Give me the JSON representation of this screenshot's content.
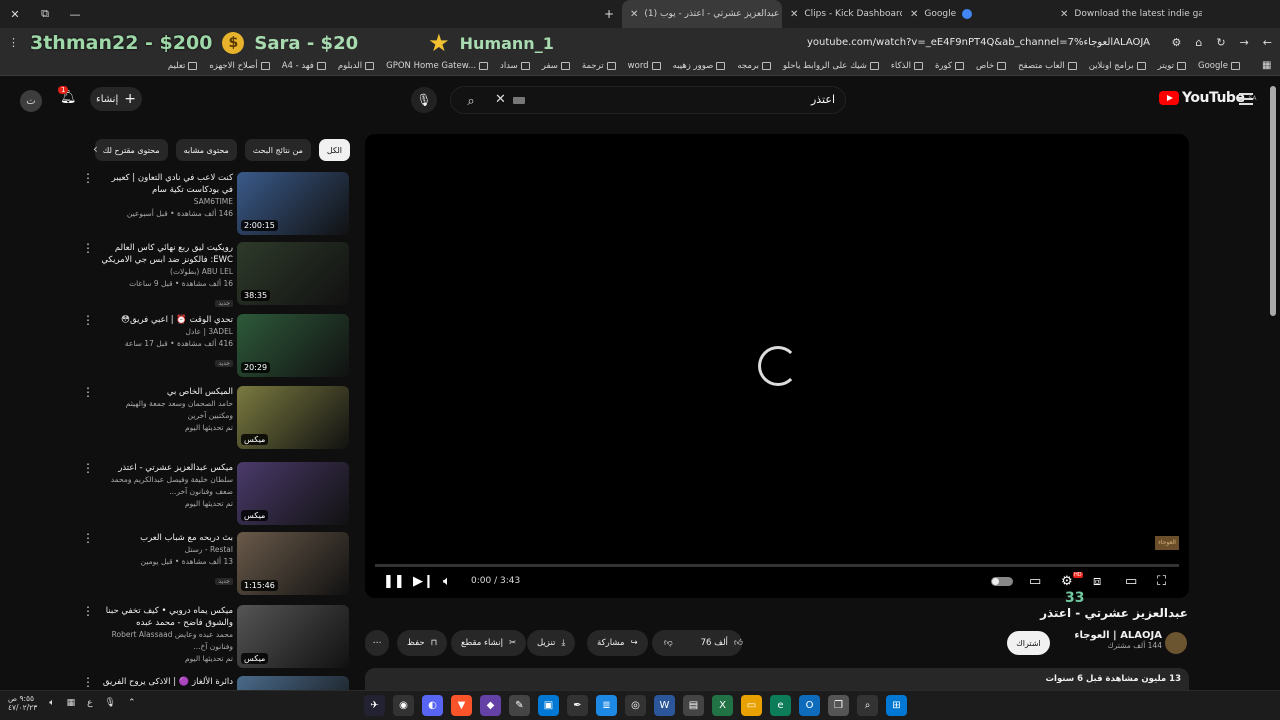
{
  "browser": {
    "tabs": [
      {
        "title": "(1) عبدالعزيز عشرتي - اعتذر - يوب",
        "active": true,
        "fav": "#ff0000"
      },
      {
        "title": "Clips - Kick Dashboard",
        "active": false,
        "fav": "#53fc18"
      },
      {
        "title": "Google",
        "active": false,
        "fav": "#4285f4"
      },
      {
        "title": "Download the latest indie gam",
        "active": false,
        "fav": "#fa5c5c"
      }
    ],
    "url": "youtube.com/watch?v=_eE4F9nPT4Q&ab_channel=7%العوجاءALAOJA",
    "bookmarks": [
      "Google",
      "تويتر",
      "برامج اونلاين",
      "العاب متصفح",
      "خاص",
      "كورة",
      "الذكاء",
      "شيك على الروابط ياحلو",
      "برمجه",
      "صوور زهيبه",
      "word",
      "ترجمة",
      "سفر",
      "سداد",
      "GPON Home Gatew...",
      "الدبلوم",
      "A4 - فهد",
      "أصلاح الاجهزه",
      "تعليم"
    ]
  },
  "overlay": {
    "donor1": "3thman22 - $200",
    "donor2": "Sara - $20",
    "donor3": "Humann_1"
  },
  "header": {
    "create_label": "إنشاء",
    "notif_count": "1",
    "search_query": "اعتذر",
    "logo_text": "YouTube",
    "region": "SA"
  },
  "chips": [
    "الكل",
    "من نتائج البحث",
    "محتوى مشابه",
    "محتوى مقترح لك"
  ],
  "related": [
    {
      "title": "كنت لاعب في نادي التعاون | كعيبر في بودكاست تكية سام",
      "channel": "SAM6TIME",
      "views": "146 ألف مشاهدة • قبل أسبوعين",
      "duration": "2:00:15",
      "badge": "",
      "thumb": "#3a5a8a"
    },
    {
      "title": "رويكيت ليق ربع نهائي كاس العالم EWC: فالكونز ضد ابس جي الامريكي 🔥 | ...",
      "channel": "ABU LEL (بطولات)",
      "views": "16 ألف مشاهدة • قبل 9 ساعات",
      "duration": "38:35",
      "badge": "جديد",
      "thumb": "#2e3a2a"
    },
    {
      "title": "تحدي الوقت ⏰ | اعبي فريق😳",
      "channel": "3ADEL | عادل",
      "views": "416 ألف مشاهدة • قبل 17 ساعة",
      "duration": "20:29",
      "badge": "جديد",
      "thumb": "#2d5a3a"
    },
    {
      "title": "الميكس الخاص بي",
      "channel": "حامد الصحمان وسعد جمعة والهيثم ومكتبين آخرين",
      "views": "تم تحديثها اليوم",
      "duration": "ميكس",
      "badge": "",
      "thumb": "#7a7a40"
    },
    {
      "title": "ميكس عبدالعزيز عشرتي - اعتذر",
      "channel": "سلطان خليفة وفيصل عبدالكريم ومحمد ضعف وفنانون آخر...",
      "views": "تم تحديثها اليوم",
      "duration": "ميكس",
      "badge": "",
      "thumb": "#4a3a6a"
    },
    {
      "title": "بث دربحه مع شباب العرب",
      "channel": "Restal - رستل",
      "views": "13 ألف مشاهدة • قبل يومين",
      "duration": "1:15:46",
      "badge": "جديد",
      "thumb": "#6a5a4a"
    },
    {
      "title": "ميكس يماه دروبي • كيف تخفي حبنا والشوق فاضح - محمد عبده",
      "channel": "محمد عبده وعايض Robert Alassaad وفنانون آخ...",
      "views": "تم تحديثها اليوم",
      "duration": "ميكس",
      "badge": "",
      "thumb": "#555555"
    },
    {
      "title": "دائرة الألغاز 🟣 | الاذكى يروح الفريق",
      "channel": "",
      "views": "",
      "duration": "",
      "badge": "",
      "thumb": "#4a6a8a"
    }
  ],
  "player": {
    "time": "0:00 / 3:43",
    "settings_badge": "HD",
    "watermark": "العوجاء"
  },
  "overlay_number": "33",
  "video": {
    "title": "عبدالعزيز عشرتي - اعتذر",
    "channel": "ALAOJA | العوجاء",
    "subs": "144 ألف مشترك",
    "subscribe": "اشتراك",
    "likes": "76 ألف",
    "share": "مشاركة",
    "download": "تنزيل",
    "clip": "إنشاء مقطع",
    "save": "حفظ",
    "desc_stats": "13 مليون مشاهدة قبل 6 سنوات"
  },
  "taskbar": {
    "time": "٩:٥٥ ص",
    "date": "٤٧/٠٢/٢٣"
  },
  "colors": {
    "brand": "#ff0000",
    "bg": "#0f0f0f",
    "chip": "#272727"
  }
}
